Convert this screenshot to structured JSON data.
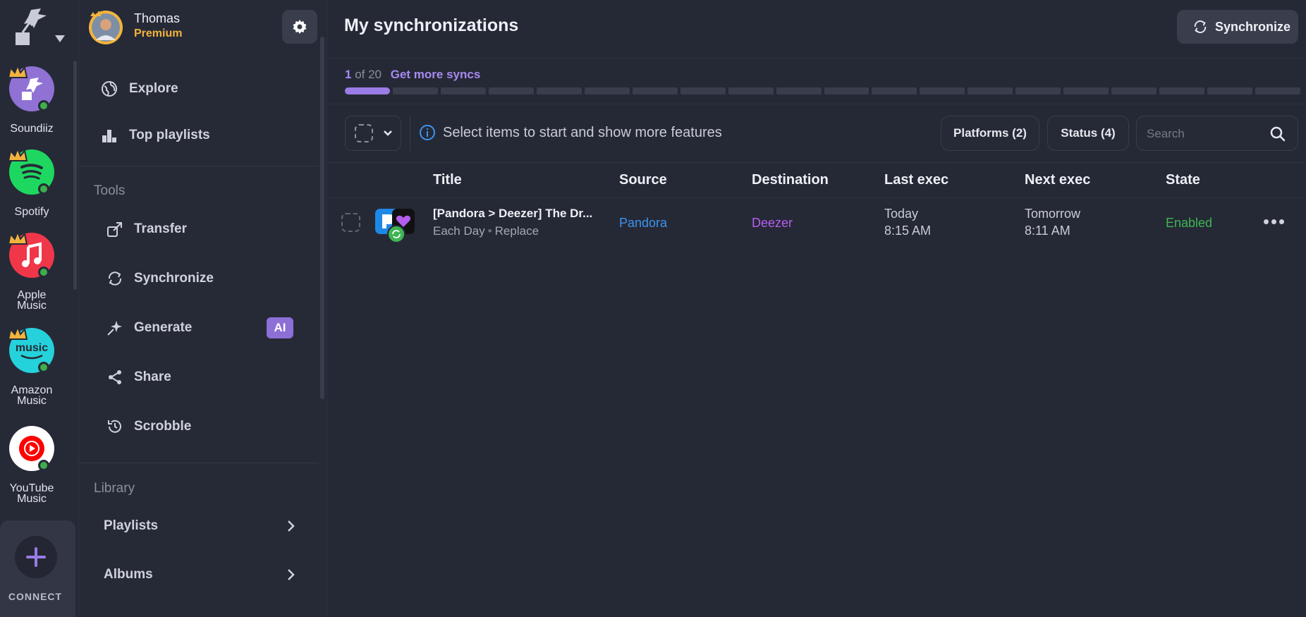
{
  "platforms": [
    {
      "label": "Soundiiz",
      "color": "#8f72d4",
      "icon": "soundiiz-icon"
    },
    {
      "label": "Spotify",
      "color": "#1ed760",
      "icon": "spotify-icon"
    },
    {
      "label": "Apple\nMusic",
      "color": "#f0374a",
      "icon": "apple-music-icon"
    },
    {
      "label": "Amazon\nMusic",
      "color": "#25d1da",
      "icon": "amazon-music-icon"
    },
    {
      "label": "YouTube\nMusic",
      "color": "#ffffff",
      "icon": "youtube-music-icon"
    }
  ],
  "connect": {
    "label": "CONNECT"
  },
  "user": {
    "name": "Thomas",
    "plan": "Premium"
  },
  "nav": {
    "explore": "Explore",
    "top_playlists": "Top playlists",
    "tools_heading": "Tools",
    "transfer": "Transfer",
    "synchronize": "Synchronize",
    "generate": "Generate",
    "ai_badge": "AI",
    "share": "Share",
    "scrobble": "Scrobble",
    "library_heading": "Library",
    "playlists": "Playlists",
    "albums": "Albums"
  },
  "header": {
    "title": "My synchronizations",
    "sync_button": "Synchronize"
  },
  "quota": {
    "current": "1",
    "of_text": "of 20",
    "more_link": "Get more syncs",
    "used": 1,
    "total": 20
  },
  "toolbar": {
    "info_text": "Select items to start and show more features",
    "platforms_filter": "Platforms (2)",
    "status_filter": "Status (4)",
    "search_placeholder": "Search"
  },
  "table": {
    "headers": [
      "Title",
      "Source",
      "Destination",
      "Last exec",
      "Next exec",
      "State"
    ],
    "rows": [
      {
        "title": "[Pandora > Deezer] The Dr...",
        "frequency": "Each Day",
        "mode": "Replace",
        "source": "Pandora",
        "destination": "Deezer",
        "last_day": "Today",
        "last_time": "8:15 AM",
        "next_day": "Tomorrow",
        "next_time": "8:11 AM",
        "state": "Enabled"
      }
    ]
  },
  "colors": {
    "accent": "#9a7ce6",
    "source": "#3b94ee",
    "destination": "#b45ef0",
    "enabled": "#3fb553",
    "premium": "#f3b33d"
  }
}
